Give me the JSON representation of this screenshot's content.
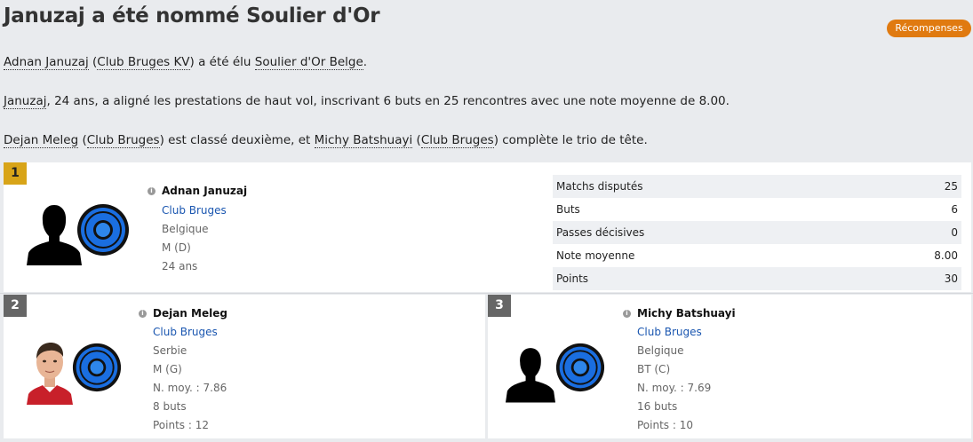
{
  "header": {
    "title": "Januzaj a été nommé Soulier d'Or",
    "badge": "Récompenses"
  },
  "paragraphs": {
    "p1": {
      "player": "Adnan Januzaj",
      "pre_club": " (",
      "club": "Club Bruges KV",
      "mid": ") a été élu ",
      "award": "Soulier d'Or Belge",
      "end": "."
    },
    "p2": {
      "player": "Januzaj",
      "rest": ", 24 ans, a aligné les prestations de haut vol, inscrivant 6 buts en 25 rencontres avec une note moyenne de 8.00."
    },
    "p3": {
      "p2name": "Dejan Meleg",
      "o1": " (",
      "c1": "Club Bruges",
      "mid": ") est classé deuxième, et ",
      "p3name": "Michy Batshuayi",
      "o2": " (",
      "c2": "Club Bruges",
      "end": ") complète le trio de tête."
    }
  },
  "first": {
    "rank": "1",
    "name": "Adnan Januzaj",
    "club": "Club Bruges",
    "nation": "Belgique",
    "position": "M (D)",
    "age": "24 ans",
    "stats": [
      {
        "label": "Matchs disputés",
        "value": "25"
      },
      {
        "label": "Buts",
        "value": "6"
      },
      {
        "label": "Passes décisives",
        "value": "0"
      },
      {
        "label": "Note moyenne",
        "value": "8.00"
      },
      {
        "label": "Points",
        "value": "30"
      }
    ]
  },
  "second": {
    "rank": "2",
    "name": "Dejan Meleg",
    "club": "Club Bruges",
    "nation": "Serbie",
    "position": "M (G)",
    "rating": "N. moy. : 7.86",
    "goals": "8 buts",
    "points": "Points : 12"
  },
  "third": {
    "rank": "3",
    "name": "Michy Batshuayi",
    "club": "Club Bruges",
    "nation": "Belgique",
    "position": "BT (C)",
    "rating": "N. moy. : 7.69",
    "goals": "16 buts",
    "points": "Points : 10"
  },
  "icons": {
    "info": "info-icon",
    "player_silhouette": "player-silhouette-icon",
    "club_crest": "club-crest-icon",
    "player_photo": "player-photo"
  },
  "colors": {
    "badge": "#e07a10",
    "link": "#1a56b0",
    "gold": "#d8a418",
    "rank_grey": "#666666"
  }
}
